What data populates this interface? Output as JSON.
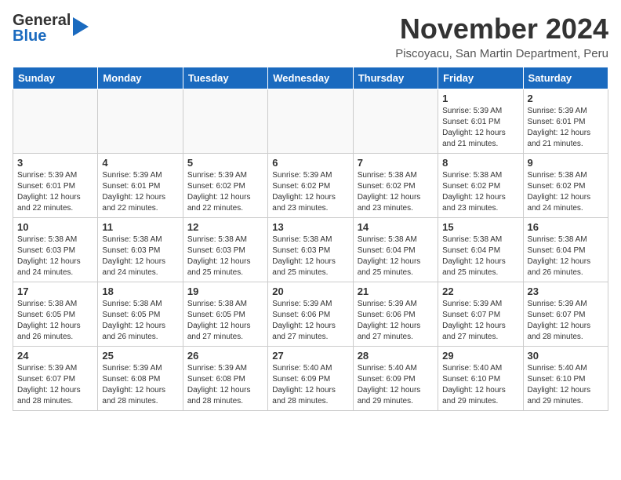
{
  "header": {
    "logo_general": "General",
    "logo_blue": "Blue",
    "month_title": "November 2024",
    "location": "Piscoyacu, San Martin Department, Peru"
  },
  "days_of_week": [
    "Sunday",
    "Monday",
    "Tuesday",
    "Wednesday",
    "Thursday",
    "Friday",
    "Saturday"
  ],
  "weeks": [
    [
      {
        "day": "",
        "info": ""
      },
      {
        "day": "",
        "info": ""
      },
      {
        "day": "",
        "info": ""
      },
      {
        "day": "",
        "info": ""
      },
      {
        "day": "",
        "info": ""
      },
      {
        "day": "1",
        "info": "Sunrise: 5:39 AM\nSunset: 6:01 PM\nDaylight: 12 hours\nand 21 minutes."
      },
      {
        "day": "2",
        "info": "Sunrise: 5:39 AM\nSunset: 6:01 PM\nDaylight: 12 hours\nand 21 minutes."
      }
    ],
    [
      {
        "day": "3",
        "info": "Sunrise: 5:39 AM\nSunset: 6:01 PM\nDaylight: 12 hours\nand 22 minutes."
      },
      {
        "day": "4",
        "info": "Sunrise: 5:39 AM\nSunset: 6:01 PM\nDaylight: 12 hours\nand 22 minutes."
      },
      {
        "day": "5",
        "info": "Sunrise: 5:39 AM\nSunset: 6:02 PM\nDaylight: 12 hours\nand 22 minutes."
      },
      {
        "day": "6",
        "info": "Sunrise: 5:39 AM\nSunset: 6:02 PM\nDaylight: 12 hours\nand 23 minutes."
      },
      {
        "day": "7",
        "info": "Sunrise: 5:38 AM\nSunset: 6:02 PM\nDaylight: 12 hours\nand 23 minutes."
      },
      {
        "day": "8",
        "info": "Sunrise: 5:38 AM\nSunset: 6:02 PM\nDaylight: 12 hours\nand 23 minutes."
      },
      {
        "day": "9",
        "info": "Sunrise: 5:38 AM\nSunset: 6:02 PM\nDaylight: 12 hours\nand 24 minutes."
      }
    ],
    [
      {
        "day": "10",
        "info": "Sunrise: 5:38 AM\nSunset: 6:03 PM\nDaylight: 12 hours\nand 24 minutes."
      },
      {
        "day": "11",
        "info": "Sunrise: 5:38 AM\nSunset: 6:03 PM\nDaylight: 12 hours\nand 24 minutes."
      },
      {
        "day": "12",
        "info": "Sunrise: 5:38 AM\nSunset: 6:03 PM\nDaylight: 12 hours\nand 25 minutes."
      },
      {
        "day": "13",
        "info": "Sunrise: 5:38 AM\nSunset: 6:03 PM\nDaylight: 12 hours\nand 25 minutes."
      },
      {
        "day": "14",
        "info": "Sunrise: 5:38 AM\nSunset: 6:04 PM\nDaylight: 12 hours\nand 25 minutes."
      },
      {
        "day": "15",
        "info": "Sunrise: 5:38 AM\nSunset: 6:04 PM\nDaylight: 12 hours\nand 25 minutes."
      },
      {
        "day": "16",
        "info": "Sunrise: 5:38 AM\nSunset: 6:04 PM\nDaylight: 12 hours\nand 26 minutes."
      }
    ],
    [
      {
        "day": "17",
        "info": "Sunrise: 5:38 AM\nSunset: 6:05 PM\nDaylight: 12 hours\nand 26 minutes."
      },
      {
        "day": "18",
        "info": "Sunrise: 5:38 AM\nSunset: 6:05 PM\nDaylight: 12 hours\nand 26 minutes."
      },
      {
        "day": "19",
        "info": "Sunrise: 5:38 AM\nSunset: 6:05 PM\nDaylight: 12 hours\nand 27 minutes."
      },
      {
        "day": "20",
        "info": "Sunrise: 5:39 AM\nSunset: 6:06 PM\nDaylight: 12 hours\nand 27 minutes."
      },
      {
        "day": "21",
        "info": "Sunrise: 5:39 AM\nSunset: 6:06 PM\nDaylight: 12 hours\nand 27 minutes."
      },
      {
        "day": "22",
        "info": "Sunrise: 5:39 AM\nSunset: 6:07 PM\nDaylight: 12 hours\nand 27 minutes."
      },
      {
        "day": "23",
        "info": "Sunrise: 5:39 AM\nSunset: 6:07 PM\nDaylight: 12 hours\nand 28 minutes."
      }
    ],
    [
      {
        "day": "24",
        "info": "Sunrise: 5:39 AM\nSunset: 6:07 PM\nDaylight: 12 hours\nand 28 minutes."
      },
      {
        "day": "25",
        "info": "Sunrise: 5:39 AM\nSunset: 6:08 PM\nDaylight: 12 hours\nand 28 minutes."
      },
      {
        "day": "26",
        "info": "Sunrise: 5:39 AM\nSunset: 6:08 PM\nDaylight: 12 hours\nand 28 minutes."
      },
      {
        "day": "27",
        "info": "Sunrise: 5:40 AM\nSunset: 6:09 PM\nDaylight: 12 hours\nand 28 minutes."
      },
      {
        "day": "28",
        "info": "Sunrise: 5:40 AM\nSunset: 6:09 PM\nDaylight: 12 hours\nand 29 minutes."
      },
      {
        "day": "29",
        "info": "Sunrise: 5:40 AM\nSunset: 6:10 PM\nDaylight: 12 hours\nand 29 minutes."
      },
      {
        "day": "30",
        "info": "Sunrise: 5:40 AM\nSunset: 6:10 PM\nDaylight: 12 hours\nand 29 minutes."
      }
    ]
  ]
}
